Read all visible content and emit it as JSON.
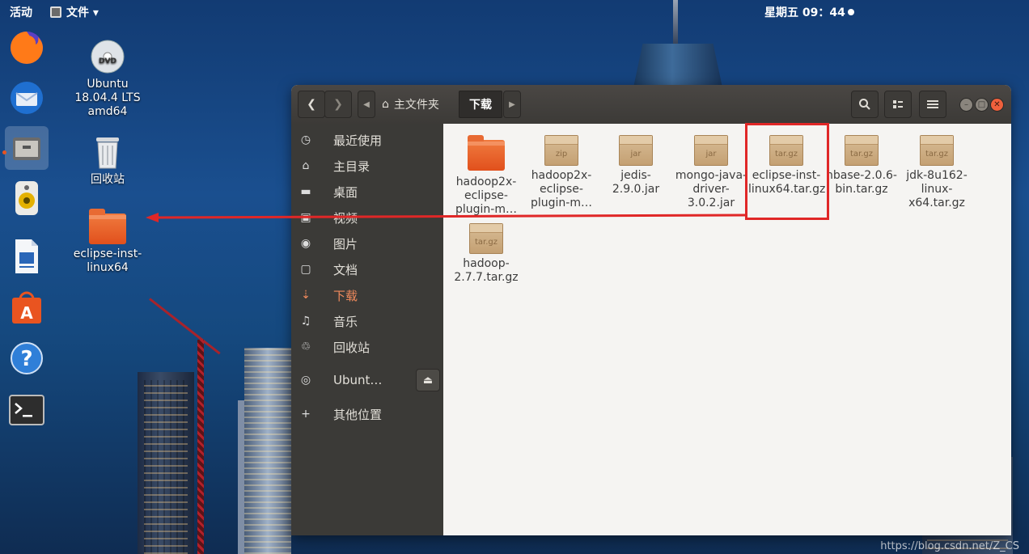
{
  "topbar": {
    "activities": "活动",
    "app_menu": "文件 ▾",
    "clock": "星期五 09：44"
  },
  "dock": [
    {
      "name": "firefox-icon"
    },
    {
      "name": "thunderbird-icon"
    },
    {
      "name": "files-icon"
    },
    {
      "name": "rhythmbox-icon"
    },
    {
      "name": "writer-icon"
    },
    {
      "name": "software-icon"
    },
    {
      "name": "help-icon"
    },
    {
      "name": "terminal-icon"
    }
  ],
  "desktop": {
    "dvd": "Ubuntu 18.04.4 LTS amd64",
    "trash": "回收站",
    "folder": "eclipse-inst-linux64"
  },
  "window": {
    "path_home": "主文件夹",
    "path_current": "下载",
    "sidebar": [
      {
        "label": "最近使用",
        "icon": "◷"
      },
      {
        "label": "主目录",
        "icon": "⌂"
      },
      {
        "label": "桌面",
        "icon": "▬"
      },
      {
        "label": "视频",
        "icon": "▣"
      },
      {
        "label": "图片",
        "icon": "◉"
      },
      {
        "label": "文档",
        "icon": "▢"
      },
      {
        "label": "下载",
        "icon": "⇣"
      },
      {
        "label": "音乐",
        "icon": "♫"
      },
      {
        "label": "回收站",
        "icon": "♲"
      },
      {
        "label": "Ubunt…",
        "icon": "◎"
      },
      {
        "label": "其他位置",
        "icon": "+"
      }
    ],
    "files": [
      {
        "name": "hadoop2x-eclipse-plugin-m…",
        "type": "folder"
      },
      {
        "name": "hadoop2x-eclipse-plugin-m…",
        "type": "zip"
      },
      {
        "name": "jedis-2.9.0.jar",
        "type": "jar"
      },
      {
        "name": "mongo-java-driver-3.0.2.jar",
        "type": "jar"
      },
      {
        "name": "eclipse-inst-linux64.tar.gz",
        "type": "tar.gz"
      },
      {
        "name": "hbase-2.0.6-bin.tar.gz",
        "type": "tar.gz"
      },
      {
        "name": "jdk-8u162-linux-x64.tar.gz",
        "type": "tar.gz"
      },
      {
        "name": "hadoop-2.7.7.tar.gz",
        "type": "tar.gz"
      }
    ]
  },
  "watermark": "https://blog.csdn.net/Z_CS",
  "colors": {
    "accent": "#e95420",
    "highlight": "#e02727"
  }
}
